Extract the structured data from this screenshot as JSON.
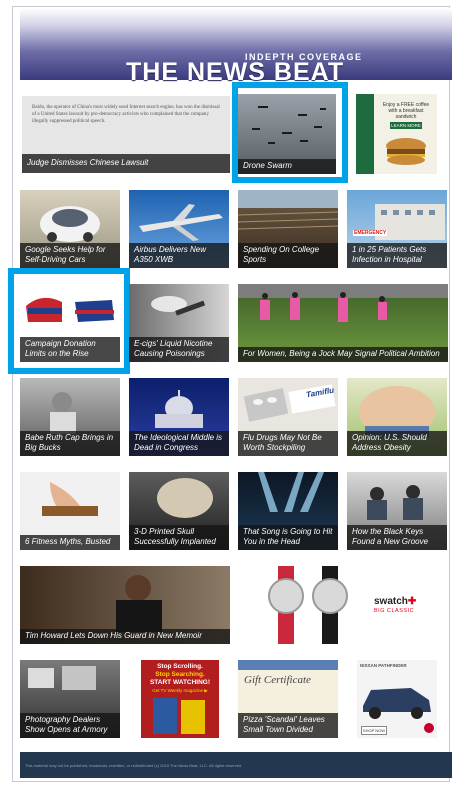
{
  "header": {
    "tagline": "INDEPTH COVERAGE",
    "brand": "THE NEWS BEAT"
  },
  "lead_story": {
    "excerpt": "Baidu, the operator of China's most widely used Internet search engine, has won the dismissal of a United States lawsuit by pro-democracy activists who complained that the company illegally suppressed political speech.",
    "caption": "Judge Dismisses Chinese Lawsuit"
  },
  "ads": {
    "burger": "Enjoy a FREE coffee with a breakfast sandwich",
    "burger_button": "LEARN MORE",
    "stop_scrolling_1": "Stop Scrolling.",
    "stop_scrolling_2": "Stop Searching.",
    "stop_scrolling_3": "START WATCHING!",
    "stop_scrolling_4": "Get TV Weekly magazine ▶",
    "watch_brand": "swatch",
    "watch_sub": "BIG CLASSIC",
    "gift": "Gift Certificate",
    "car_brand": "NISSAN PATHFINDER",
    "car_button": "SHOP NOW"
  },
  "stories": {
    "drone": "Drone Swarm",
    "google": "Google Seeks Help for Self-Driving Cars",
    "airbus": "Airbus Delivers New A350 XWB",
    "sports": "Spending On College Sports",
    "hospital_tag": "EMERGENCY",
    "hospital": "1 in 25 Patients Gets Infection in Hospital",
    "donation": "Campaign Donation Limits on the Rise",
    "ecig": "E-cigs' Liquid Nicotine Causing Poisonings",
    "women": "For Women, Being a Jock May Signal Political Ambition",
    "ruth": "Babe Ruth Cap Brings in Big Bucks",
    "middle": "The Ideological Middle is Dead in Congress",
    "flu": "Flu Drugs May Not Be Worth Stockpiling",
    "obesity": "Opinion: U.S. Should Address Obesity",
    "fitness": "6 Fitness Myths, Busted",
    "skull": "3-D Printed Skull Successfully Implanted",
    "song": "That Song is Going to Hit You in the Head",
    "groove": "How the Black Keys Found a New Groove",
    "howard": "Tim Howard Lets Down His Guard in New Memoir",
    "photo": "Photography Dealers Show Opens at Armory",
    "pizza": "Pizza 'Scandal' Leaves Small Town Divided"
  },
  "drug_label": "Tamiflu",
  "footer": "This material may not be published, broadcast, rewritten, or redistributed (c) 2015 The News Beat, LLC. All rights reserved."
}
